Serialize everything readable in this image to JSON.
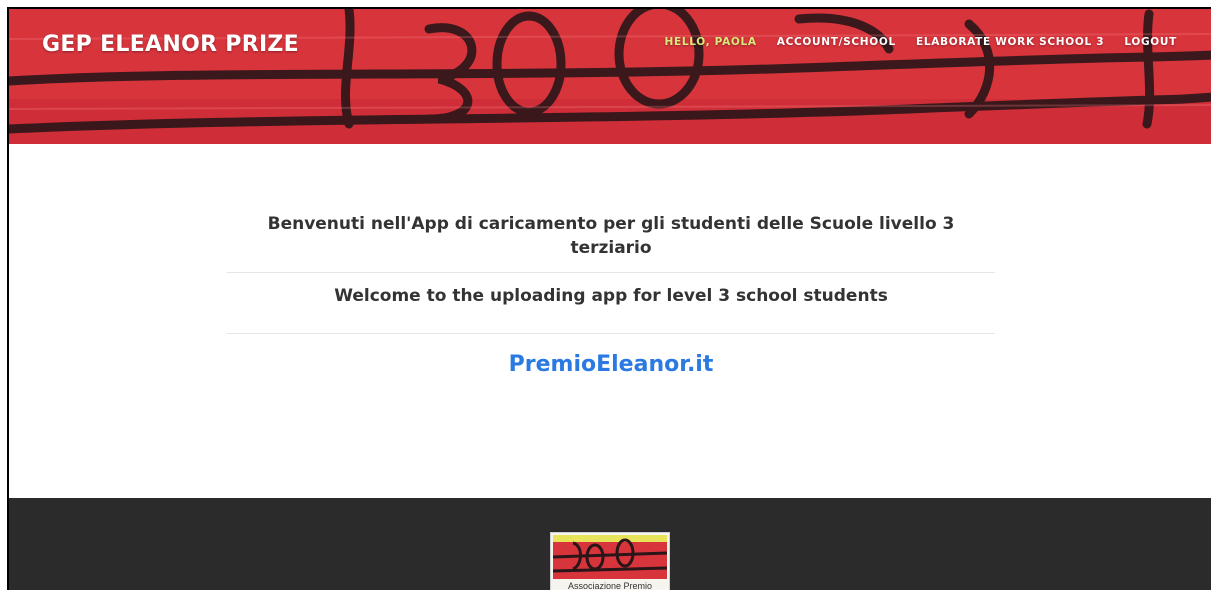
{
  "header": {
    "brand": "GEP ELEANOR PRIZE",
    "nav": {
      "greeting": "HELLO, PAOLA",
      "account": "ACCOUNT/SCHOOL",
      "elaborate": "ELABORATE WORK SCHOOL 3",
      "logout": "LOGOUT"
    }
  },
  "main": {
    "welcome_it": "Benvenuti nell'App di caricamento per gli studenti delle Scuole livello 3 terziario",
    "welcome_en": "Welcome to the uploading app for level 3 school students",
    "site_link": "PremioEleanor.it"
  },
  "footer": {
    "logo_text": "Associazione Premio"
  },
  "colors": {
    "header_red": "#d8343c",
    "nav_active": "#d9e87a",
    "link_blue": "#2a7ae2",
    "footer_bg": "#2b2b2b"
  }
}
